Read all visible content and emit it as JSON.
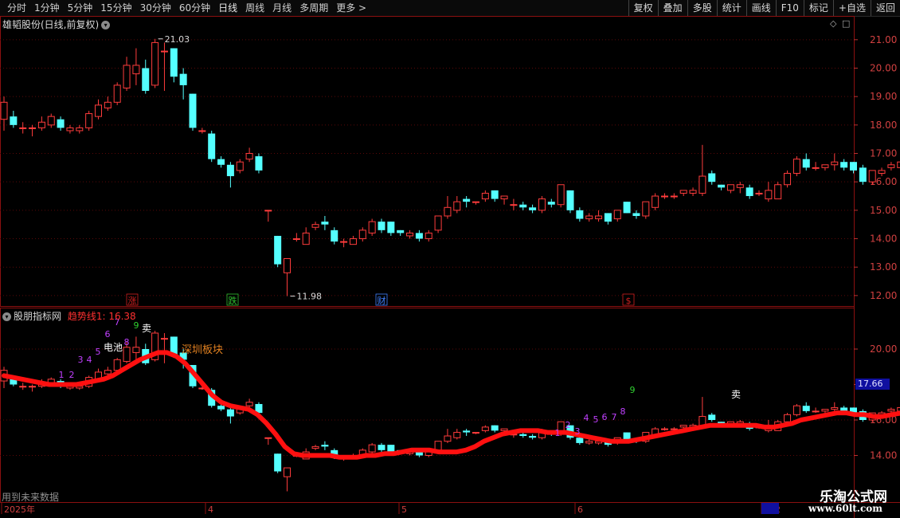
{
  "toolbar": {
    "periods": [
      "分时",
      "1分钟",
      "5分钟",
      "15分钟",
      "30分钟",
      "60分钟",
      "日线",
      "周线",
      "月线",
      "多周期",
      "更多 >"
    ],
    "active_period": "日线",
    "right_buttons": [
      "复权",
      "叠加",
      "多股",
      "统计",
      "画线",
      "F10",
      "标记",
      "+自选",
      "返回"
    ]
  },
  "main_panel": {
    "title": "雄韬股份(日线,前复权)",
    "high_label": "21.03",
    "low_label": "11.98",
    "markers": [
      {
        "text": "涨",
        "color": "#d02020"
      },
      {
        "text": "跌",
        "color": "#30c030"
      },
      {
        "text": "财",
        "color": "#4080ff"
      },
      {
        "text": "$",
        "color": "#d02020"
      }
    ],
    "y_ticks": [
      "21.00",
      "20.00",
      "19.00",
      "18.00",
      "17.00",
      "16.00",
      "15.00",
      "14.00",
      "13.00",
      "12.00"
    ]
  },
  "indicator_panel": {
    "title": "股朋指标网",
    "trend_label": "趋势线1: 16.38",
    "sector_label": "深圳板块",
    "sell_labels": [
      "卖",
      "卖"
    ],
    "battery_label": "电池",
    "counts_a": [
      "1",
      "2",
      "3",
      "4",
      "5",
      "6",
      "7",
      "8",
      "9"
    ],
    "counts_b": [
      "1",
      "2",
      "3",
      "4",
      "5",
      "6",
      "7",
      "8",
      "9"
    ],
    "y_ticks": [
      "20.00",
      "16.00",
      "14.00"
    ],
    "current_price_tag": "17.66",
    "future_data_note": "用到未来数据"
  },
  "time_axis": {
    "labels": [
      "2025年",
      "4",
      "5",
      "6",
      "202"
    ]
  },
  "watermark": {
    "name": "乐淘公式网",
    "url": "www.60lt.com"
  },
  "chart_data": {
    "type": "candlestick",
    "ylim": [
      11.8,
      21.5
    ],
    "candles": [
      [
        18.2,
        18.8,
        17.8,
        19.0
      ],
      [
        18.3,
        18.0,
        17.9,
        18.5
      ],
      [
        17.9,
        17.9,
        17.7,
        18.1
      ],
      [
        17.9,
        17.9,
        17.6,
        18.0
      ],
      [
        17.9,
        18.1,
        17.8,
        18.3
      ],
      [
        18.0,
        18.3,
        17.9,
        18.4
      ],
      [
        18.2,
        17.9,
        17.8,
        18.3
      ],
      [
        17.8,
        17.9,
        17.7,
        18.0
      ],
      [
        17.8,
        17.9,
        17.7,
        18.0
      ],
      [
        17.9,
        18.4,
        17.8,
        18.5
      ],
      [
        18.3,
        18.7,
        18.2,
        18.9
      ],
      [
        18.6,
        18.8,
        18.5,
        19.0
      ],
      [
        18.8,
        19.4,
        18.7,
        19.5
      ],
      [
        19.3,
        20.1,
        19.2,
        20.4
      ],
      [
        19.8,
        20.1,
        19.4,
        20.7
      ],
      [
        20.0,
        19.2,
        19.1,
        20.3
      ],
      [
        19.4,
        20.9,
        19.3,
        21.03
      ],
      [
        20.6,
        20.6,
        19.2,
        20.9
      ],
      [
        20.7,
        19.7,
        19.5,
        20.7
      ],
      [
        19.8,
        19.4,
        18.9,
        20.0
      ],
      [
        19.1,
        17.9,
        17.8,
        19.1
      ],
      [
        17.8,
        17.8,
        17.7,
        17.9
      ],
      [
        17.7,
        16.8,
        16.7,
        17.8
      ],
      [
        16.8,
        16.6,
        16.5,
        16.9
      ],
      [
        16.6,
        16.2,
        15.8,
        16.7
      ],
      [
        16.4,
        16.7,
        16.3,
        16.8
      ],
      [
        16.8,
        17.0,
        16.7,
        17.2
      ],
      [
        16.9,
        16.4,
        16.3,
        17.0
      ],
      [
        15.0,
        15.0,
        14.6,
        15.0
      ],
      [
        14.1,
        13.1,
        13.0,
        14.1
      ],
      [
        12.8,
        13.3,
        11.98,
        13.3
      ],
      [
        14.0,
        14.0,
        13.9,
        14.2
      ],
      [
        13.8,
        14.2,
        13.8,
        14.4
      ],
      [
        14.4,
        14.5,
        14.3,
        14.6
      ],
      [
        14.6,
        14.5,
        14.3,
        14.8
      ],
      [
        14.3,
        13.9,
        13.8,
        14.4
      ],
      [
        13.9,
        13.9,
        13.7,
        14.0
      ],
      [
        13.8,
        14.0,
        13.8,
        14.1
      ],
      [
        14.0,
        14.3,
        13.9,
        14.4
      ],
      [
        14.2,
        14.6,
        14.1,
        14.7
      ],
      [
        14.6,
        14.3,
        14.2,
        14.7
      ],
      [
        14.6,
        14.2,
        14.1,
        14.6
      ],
      [
        14.3,
        14.2,
        14.1,
        14.3
      ],
      [
        14.1,
        14.2,
        14.0,
        14.3
      ],
      [
        14.2,
        14.0,
        13.9,
        14.3
      ],
      [
        14.0,
        14.2,
        13.9,
        14.3
      ],
      [
        14.3,
        14.8,
        14.2,
        14.8
      ],
      [
        14.8,
        15.1,
        14.7,
        15.5
      ],
      [
        15.0,
        15.3,
        14.9,
        15.5
      ],
      [
        15.4,
        15.3,
        15.1,
        15.5
      ],
      [
        15.3,
        15.3,
        15.2,
        15.3
      ],
      [
        15.4,
        15.6,
        15.3,
        15.7
      ],
      [
        15.7,
        15.4,
        15.3,
        15.7
      ],
      [
        15.4,
        15.5,
        15.2,
        15.5
      ],
      [
        15.2,
        15.2,
        15.0,
        15.4
      ],
      [
        15.2,
        15.1,
        15.0,
        15.3
      ],
      [
        15.1,
        15.0,
        14.9,
        15.2
      ],
      [
        15.0,
        15.4,
        14.9,
        15.5
      ],
      [
        15.3,
        15.2,
        15.1,
        15.4
      ],
      [
        15.2,
        15.9,
        15.1,
        15.9
      ],
      [
        15.7,
        15.0,
        14.9,
        15.7
      ],
      [
        15.0,
        14.7,
        14.6,
        15.1
      ],
      [
        14.7,
        14.8,
        14.6,
        14.9
      ],
      [
        14.7,
        14.8,
        14.6,
        15.0
      ],
      [
        14.9,
        14.6,
        14.5,
        14.9
      ],
      [
        14.7,
        15.0,
        14.6,
        15.0
      ],
      [
        15.3,
        14.9,
        14.9,
        15.3
      ],
      [
        14.9,
        14.8,
        14.7,
        15.0
      ],
      [
        14.8,
        15.3,
        14.7,
        15.3
      ],
      [
        15.1,
        15.5,
        15.0,
        15.6
      ],
      [
        15.5,
        15.5,
        15.4,
        15.6
      ],
      [
        15.5,
        15.5,
        15.4,
        15.6
      ],
      [
        15.6,
        15.7,
        15.5,
        15.7
      ],
      [
        15.6,
        15.7,
        15.5,
        15.8
      ],
      [
        15.6,
        16.2,
        15.5,
        17.3
      ],
      [
        16.3,
        16.0,
        15.9,
        16.4
      ],
      [
        15.9,
        15.8,
        15.7,
        15.9
      ],
      [
        15.7,
        15.9,
        15.6,
        15.9
      ],
      [
        15.8,
        15.9,
        15.6,
        16.0
      ],
      [
        15.8,
        15.5,
        15.4,
        15.9
      ],
      [
        15.6,
        15.6,
        15.5,
        15.7
      ],
      [
        15.4,
        15.7,
        15.3,
        16.0
      ],
      [
        15.4,
        15.9,
        15.4,
        16.0
      ],
      [
        15.9,
        16.3,
        15.8,
        16.4
      ],
      [
        16.3,
        16.8,
        16.2,
        16.9
      ],
      [
        16.8,
        16.5,
        16.4,
        17.0
      ],
      [
        16.5,
        16.5,
        16.4,
        16.7
      ],
      [
        16.5,
        16.6,
        16.4,
        16.6
      ],
      [
        16.6,
        16.7,
        16.4,
        17.0
      ],
      [
        16.7,
        16.5,
        16.4,
        16.8
      ],
      [
        16.7,
        16.4,
        16.3,
        16.7
      ],
      [
        16.5,
        16.0,
        15.9,
        16.6
      ],
      [
        16.0,
        16.4,
        15.9,
        16.4
      ],
      [
        16.3,
        16.4,
        16.2,
        16.5
      ],
      [
        16.5,
        16.6,
        16.4,
        16.7
      ],
      [
        16.5,
        16.7,
        16.4,
        17.0
      ]
    ],
    "trend_line": [
      18.5,
      18.4,
      18.3,
      18.2,
      18.1,
      18.0,
      18.0,
      18.0,
      18.0,
      18.1,
      18.2,
      18.3,
      18.5,
      18.8,
      19.1,
      19.4,
      19.6,
      19.8,
      19.8,
      19.6,
      19.2,
      18.6,
      18.0,
      17.4,
      17.0,
      16.8,
      16.7,
      16.6,
      16.3,
      15.8,
      15.2,
      14.5,
      14.1,
      14.0,
      14.0,
      14.0,
      14.0,
      13.9,
      13.9,
      13.9,
      14.0,
      14.0,
      14.1,
      14.1,
      14.2,
      14.3,
      14.3,
      14.3,
      14.2,
      14.2,
      14.2,
      14.3,
      14.5,
      14.8,
      15.0,
      15.2,
      15.3,
      15.4,
      15.4,
      15.4,
      15.3,
      15.3,
      15.3,
      15.2,
      15.1,
      15.0,
      14.9,
      14.8,
      14.8,
      14.8,
      14.9,
      15.0,
      15.1,
      15.2,
      15.3,
      15.4,
      15.5,
      15.6,
      15.7,
      15.7,
      15.7,
      15.7,
      15.7,
      15.7,
      15.6,
      15.6,
      15.7,
      15.8,
      16.0,
      16.1,
      16.2,
      16.3,
      16.4,
      16.4,
      16.3,
      16.3,
      16.2,
      16.2,
      16.3,
      16.38
    ]
  }
}
